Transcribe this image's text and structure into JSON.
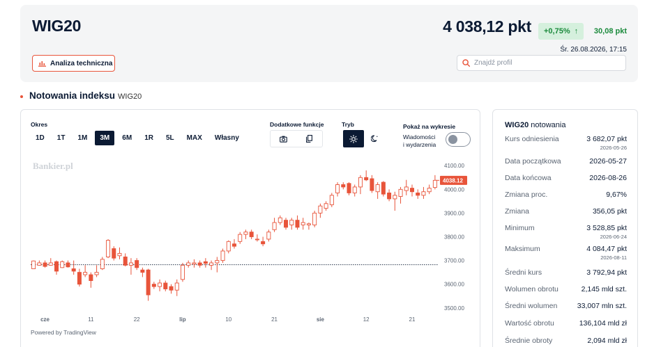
{
  "header": {
    "title": "WIG20",
    "analysis_button": "Analiza techniczna",
    "price": "4 038,12 pkt",
    "change_pct": "+0,75%",
    "change_arrow": "↑",
    "change_abs": "30,08 pkt",
    "datetime": "Śr. 26.08.2026, 17:15",
    "search_placeholder": "Znajdź profil"
  },
  "section": {
    "title": "Notowania indeksu",
    "subtitle": "WIG20"
  },
  "controls": {
    "period_label": "Okres",
    "periods": [
      "1D",
      "1T",
      "1M",
      "3M",
      "6M",
      "1R",
      "5L",
      "MAX",
      "Własny"
    ],
    "active_period": "3M",
    "functions_label": "Dodatkowe funkcje",
    "mode_label": "Tryb",
    "show_label": "Pokaż na wykresie",
    "events_line1": "Wiadomości",
    "events_line2": "i wydarzenia",
    "events_enabled": false
  },
  "chart_data": {
    "type": "candlestick",
    "watermark": "Bankier.pl",
    "powered_by": "Powered by TradingView",
    "y_ticks": [
      "4100.00",
      "4000.00",
      "3900.00",
      "3800.00",
      "3700.00",
      "3600.00",
      "3500.00"
    ],
    "y_range": [
      3470,
      4130
    ],
    "x_labels": [
      {
        "label": "cze",
        "idx": 2
      },
      {
        "label": "11",
        "idx": 10
      },
      {
        "label": "22",
        "idx": 18
      },
      {
        "label": "lip",
        "idx": 26
      },
      {
        "label": "10",
        "idx": 34
      },
      {
        "label": "21",
        "idx": 42
      },
      {
        "label": "sie",
        "idx": 50
      },
      {
        "label": "12",
        "idx": 58
      },
      {
        "label": "21",
        "idx": 66
      }
    ],
    "reference_level": 3682.07,
    "last_price_label": "4038.12",
    "colors": {
      "up": "#e8543a",
      "down": "#e8543a",
      "accent": "#e8543a",
      "positive": "#1b8a3c"
    },
    "candles": [
      [
        3665,
        3700,
        3668,
        3698
      ],
      [
        3680,
        3700,
        3678,
        3690
      ],
      [
        3690,
        3700,
        3670,
        3675
      ],
      [
        3680,
        3710,
        3678,
        3690
      ],
      [
        3695,
        3700,
        3640,
        3655
      ],
      [
        3670,
        3700,
        3668,
        3695
      ],
      [
        3690,
        3700,
        3670,
        3673
      ],
      [
        3665,
        3700,
        3640,
        3655
      ],
      [
        3650,
        3665,
        3590,
        3600
      ],
      [
        3640,
        3680,
        3630,
        3650
      ],
      [
        3640,
        3650,
        3585,
        3615
      ],
      [
        3640,
        3680,
        3630,
        3650
      ],
      [
        3665,
        3715,
        3660,
        3705
      ],
      [
        3715,
        3790,
        3710,
        3785
      ],
      [
        3750,
        3760,
        3700,
        3710
      ],
      [
        3720,
        3755,
        3705,
        3730
      ],
      [
        3715,
        3730,
        3675,
        3680
      ],
      [
        3680,
        3710,
        3640,
        3690
      ],
      [
        3700,
        3710,
        3660,
        3670
      ],
      [
        3660,
        3670,
        3630,
        3650
      ],
      [
        3660,
        3665,
        3530,
        3555
      ],
      [
        3600,
        3610,
        3580,
        3590
      ],
      [
        3590,
        3620,
        3570,
        3605
      ],
      [
        3605,
        3615,
        3570,
        3580
      ],
      [
        3590,
        3600,
        3560,
        3575
      ],
      [
        3575,
        3620,
        3550,
        3605
      ],
      [
        3620,
        3690,
        3610,
        3680
      ],
      [
        3680,
        3700,
        3670,
        3690
      ],
      [
        3685,
        3705,
        3670,
        3690
      ],
      [
        3690,
        3700,
        3670,
        3680
      ],
      [
        3695,
        3710,
        3670,
        3688
      ],
      [
        3680,
        3700,
        3660,
        3690
      ],
      [
        3690,
        3715,
        3650,
        3700
      ],
      [
        3700,
        3750,
        3690,
        3740
      ],
      [
        3740,
        3785,
        3730,
        3780
      ],
      [
        3770,
        3790,
        3750,
        3760
      ],
      [
        3780,
        3820,
        3770,
        3810
      ],
      [
        3810,
        3830,
        3790,
        3820
      ],
      [
        3820,
        3830,
        3790,
        3800
      ],
      [
        3790,
        3810,
        3780,
        3790
      ],
      [
        3780,
        3800,
        3760,
        3770
      ],
      [
        3790,
        3830,
        3780,
        3820
      ],
      [
        3830,
        3880,
        3820,
        3860
      ],
      [
        3860,
        3890,
        3850,
        3880
      ],
      [
        3870,
        3880,
        3830,
        3840
      ],
      [
        3850,
        3880,
        3830,
        3870
      ],
      [
        3870,
        3890,
        3830,
        3840
      ],
      [
        3850,
        3880,
        3830,
        3860
      ],
      [
        3850,
        3860,
        3830,
        3855
      ],
      [
        3850,
        3910,
        3840,
        3900
      ],
      [
        3900,
        3940,
        3880,
        3930
      ],
      [
        3920,
        3950,
        3910,
        3940
      ],
      [
        3935,
        3985,
        3925,
        3975
      ],
      [
        3985,
        4030,
        3970,
        4020
      ],
      [
        4020,
        4030,
        4000,
        4010
      ],
      [
        4025,
        4030,
        3975,
        3985
      ],
      [
        3985,
        4020,
        3970,
        4010
      ],
      [
        4010,
        4060,
        3980,
        4050
      ],
      [
        4050,
        4080,
        4035,
        4040
      ],
      [
        4045,
        4060,
        3985,
        3995
      ],
      [
        3990,
        4030,
        3960,
        4020
      ],
      [
        4030,
        4035,
        3970,
        3980
      ],
      [
        3985,
        4000,
        3950,
        3960
      ],
      [
        3960,
        3990,
        3910,
        3975
      ],
      [
        3970,
        4010,
        3940,
        4000
      ],
      [
        3995,
        4040,
        3975,
        4010
      ],
      [
        4005,
        4020,
        3970,
        3990
      ],
      [
        3985,
        4000,
        3960,
        3975
      ],
      [
        3975,
        4010,
        3960,
        3990
      ],
      [
        3990,
        4020,
        3980,
        4005
      ],
      [
        4008,
        4060,
        4000,
        4038.12
      ]
    ]
  },
  "quote": {
    "title_bold": "WIG20",
    "title_rest": "notowania",
    "rows": [
      {
        "k": "Kurs odniesienia",
        "v": "3 682,07 pkt",
        "d": "2026-05-26"
      },
      {
        "k": "Data początkowa",
        "v": "2026-05-27",
        "d": ""
      },
      {
        "k": "Data końcowa",
        "v": "2026-08-26",
        "d": ""
      },
      {
        "k": "Zmiana proc.",
        "v": "9,67%",
        "d": ""
      },
      {
        "k": "Zmiana",
        "v": "356,05 pkt",
        "d": ""
      },
      {
        "k": "Minimum",
        "v": "3 528,85 pkt",
        "d": "2026-06-24"
      },
      {
        "k": "Maksimum",
        "v": "4 084,47 pkt",
        "d": "2026-08-11"
      },
      {
        "k": "Średni kurs",
        "v": "3 792,94 pkt",
        "d": ""
      },
      {
        "k": "Wolumen obrotu",
        "v": "2,145 mld szt.",
        "d": ""
      },
      {
        "k": "Średni wolumen",
        "v": "33,007 mln szt.",
        "d": ""
      },
      {
        "k": "Wartość obrotu",
        "v": "136,104 mld zł",
        "d": ""
      },
      {
        "k": "Średnie obroty",
        "v": "2,094 mld zł",
        "d": ""
      }
    ]
  }
}
